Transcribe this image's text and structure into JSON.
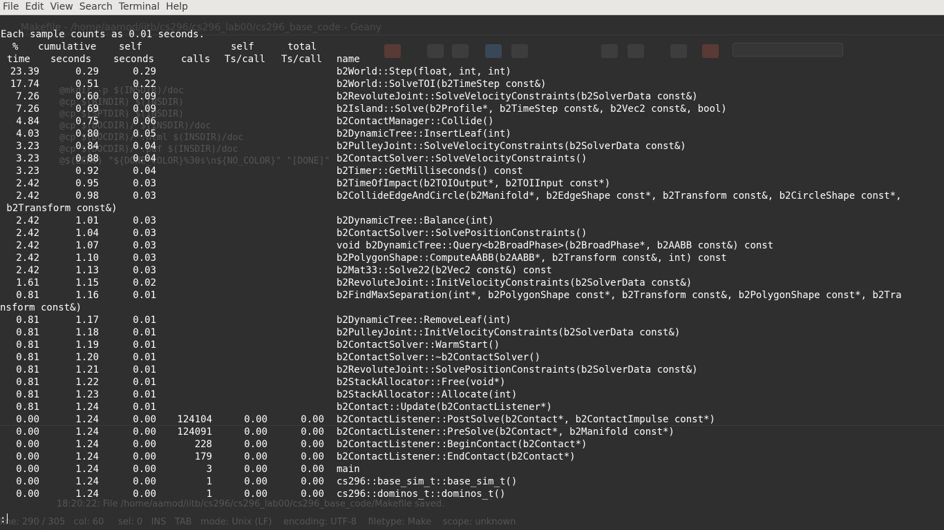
{
  "menu": [
    "File",
    "Edit",
    "View",
    "Search",
    "Terminal",
    "Help"
  ],
  "header_note": "Each sample counts as 0.01 seconds.",
  "column_headers_1": {
    "pct": "%",
    "cumulative": "cumulative",
    "self": "self",
    "self_call": "self",
    "total_call": "total"
  },
  "column_headers_2": {
    "pct": "time",
    "cumulative": "seconds",
    "self": "seconds",
    "calls": "calls",
    "self_call": "Ts/call",
    "total_call": "Ts/call",
    "name": "name"
  },
  "rows": [
    {
      "pct": "23.39",
      "cum": "0.29",
      "self": "0.29",
      "calls": "",
      "scall": "",
      "tcall": "",
      "name": "b2World::Step(float, int, int)"
    },
    {
      "pct": "17.74",
      "cum": "0.51",
      "self": "0.22",
      "calls": "",
      "scall": "",
      "tcall": "",
      "name": "b2World::SolveTOI(b2TimeStep const&)"
    },
    {
      "pct": "7.26",
      "cum": "0.60",
      "self": "0.09",
      "calls": "",
      "scall": "",
      "tcall": "",
      "name": "b2RevoluteJoint::SolveVelocityConstraints(b2SolverData const&)"
    },
    {
      "pct": "7.26",
      "cum": "0.69",
      "self": "0.09",
      "calls": "",
      "scall": "",
      "tcall": "",
      "name": "b2Island::Solve(b2Profile*, b2TimeStep const&, b2Vec2 const&, bool)"
    },
    {
      "pct": "4.84",
      "cum": "0.75",
      "self": "0.06",
      "calls": "",
      "scall": "",
      "tcall": "",
      "name": "b2ContactManager::Collide()"
    },
    {
      "pct": "4.03",
      "cum": "0.80",
      "self": "0.05",
      "calls": "",
      "scall": "",
      "tcall": "",
      "name": "b2DynamicTree::InsertLeaf(int)"
    },
    {
      "pct": "3.23",
      "cum": "0.84",
      "self": "0.04",
      "calls": "",
      "scall": "",
      "tcall": "",
      "name": "b2PulleyJoint::SolveVelocityConstraints(b2SolverData const&)"
    },
    {
      "pct": "3.23",
      "cum": "0.88",
      "self": "0.04",
      "calls": "",
      "scall": "",
      "tcall": "",
      "name": "b2ContactSolver::SolveVelocityConstraints()"
    },
    {
      "pct": "3.23",
      "cum": "0.92",
      "self": "0.04",
      "calls": "",
      "scall": "",
      "tcall": "",
      "name": "b2Timer::GetMilliseconds() const"
    },
    {
      "pct": "2.42",
      "cum": "0.95",
      "self": "0.03",
      "calls": "",
      "scall": "",
      "tcall": "",
      "name": "b2TimeOfImpact(b2TOIOutput*, b2TOIInput const*)"
    },
    {
      "pct": "2.42",
      "cum": "0.98",
      "self": "0.03",
      "calls": "",
      "scall": "",
      "tcall": "",
      "name": "b2CollideEdgeAndCircle(b2Manifold*, b2EdgeShape const*, b2Transform const&, b2CircleShape const*,",
      "wrap": " b2Transform const&)"
    },
    {
      "pct": "2.42",
      "cum": "1.01",
      "self": "0.03",
      "calls": "",
      "scall": "",
      "tcall": "",
      "name": "b2DynamicTree::Balance(int)"
    },
    {
      "pct": "2.42",
      "cum": "1.04",
      "self": "0.03",
      "calls": "",
      "scall": "",
      "tcall": "",
      "name": "b2ContactSolver::SolvePositionConstraints()"
    },
    {
      "pct": "2.42",
      "cum": "1.07",
      "self": "0.03",
      "calls": "",
      "scall": "",
      "tcall": "",
      "name": "void b2DynamicTree::Query<b2BroadPhase>(b2BroadPhase*, b2AABB const&) const"
    },
    {
      "pct": "2.42",
      "cum": "1.10",
      "self": "0.03",
      "calls": "",
      "scall": "",
      "tcall": "",
      "name": "b2PolygonShape::ComputeAABB(b2AABB*, b2Transform const&, int) const"
    },
    {
      "pct": "2.42",
      "cum": "1.13",
      "self": "0.03",
      "calls": "",
      "scall": "",
      "tcall": "",
      "name": "b2Mat33::Solve22(b2Vec2 const&) const"
    },
    {
      "pct": "1.61",
      "cum": "1.15",
      "self": "0.02",
      "calls": "",
      "scall": "",
      "tcall": "",
      "name": "b2RevoluteJoint::InitVelocityConstraints(b2SolverData const&)"
    },
    {
      "pct": "0.81",
      "cum": "1.16",
      "self": "0.01",
      "calls": "",
      "scall": "",
      "tcall": "",
      "name": "b2FindMaxSeparation(int*, b2PolygonShape const*, b2Transform const&, b2PolygonShape const*, b2Tra",
      "wrap": "nsform const&)"
    },
    {
      "pct": "0.81",
      "cum": "1.17",
      "self": "0.01",
      "calls": "",
      "scall": "",
      "tcall": "",
      "name": "b2DynamicTree::RemoveLeaf(int)"
    },
    {
      "pct": "0.81",
      "cum": "1.18",
      "self": "0.01",
      "calls": "",
      "scall": "",
      "tcall": "",
      "name": "b2PulleyJoint::InitVelocityConstraints(b2SolverData const&)"
    },
    {
      "pct": "0.81",
      "cum": "1.19",
      "self": "0.01",
      "calls": "",
      "scall": "",
      "tcall": "",
      "name": "b2ContactSolver::WarmStart()"
    },
    {
      "pct": "0.81",
      "cum": "1.20",
      "self": "0.01",
      "calls": "",
      "scall": "",
      "tcall": "",
      "name": "b2ContactSolver::~b2ContactSolver()"
    },
    {
      "pct": "0.81",
      "cum": "1.21",
      "self": "0.01",
      "calls": "",
      "scall": "",
      "tcall": "",
      "name": "b2RevoluteJoint::SolvePositionConstraints(b2SolverData const&)"
    },
    {
      "pct": "0.81",
      "cum": "1.22",
      "self": "0.01",
      "calls": "",
      "scall": "",
      "tcall": "",
      "name": "b2StackAllocator::Free(void*)"
    },
    {
      "pct": "0.81",
      "cum": "1.23",
      "self": "0.01",
      "calls": "",
      "scall": "",
      "tcall": "",
      "name": "b2StackAllocator::Allocate(int)"
    },
    {
      "pct": "0.81",
      "cum": "1.24",
      "self": "0.01",
      "calls": "",
      "scall": "",
      "tcall": "",
      "name": "b2Contact::Update(b2ContactListener*)"
    },
    {
      "pct": "0.00",
      "cum": "1.24",
      "self": "0.00",
      "calls": "124104",
      "scall": "0.00",
      "tcall": "0.00",
      "name": "b2ContactListener::PostSolve(b2Contact*, b2ContactImpulse const*)"
    },
    {
      "pct": "0.00",
      "cum": "1.24",
      "self": "0.00",
      "calls": "124091",
      "scall": "0.00",
      "tcall": "0.00",
      "name": "b2ContactListener::PreSolve(b2Contact*, b2Manifold const*)"
    },
    {
      "pct": "0.00",
      "cum": "1.24",
      "self": "0.00",
      "calls": "228",
      "scall": "0.00",
      "tcall": "0.00",
      "name": "b2ContactListener::BeginContact(b2Contact*)"
    },
    {
      "pct": "0.00",
      "cum": "1.24",
      "self": "0.00",
      "calls": "179",
      "scall": "0.00",
      "tcall": "0.00",
      "name": "b2ContactListener::EndContact(b2Contact*)"
    },
    {
      "pct": "0.00",
      "cum": "1.24",
      "self": "0.00",
      "calls": "3",
      "scall": "0.00",
      "tcall": "0.00",
      "name": "main"
    },
    {
      "pct": "0.00",
      "cum": "1.24",
      "self": "0.00",
      "calls": "1",
      "scall": "0.00",
      "tcall": "0.00",
      "name": "cs296::base_sim_t::base_sim_t()"
    },
    {
      "pct": "0.00",
      "cum": "1.24",
      "self": "0.00",
      "calls": "1",
      "scall": "0.00",
      "tcall": "0.00",
      "name": "cs296::dominos_t::dominos_t()"
    }
  ],
  "prompt": ":",
  "background_editor": {
    "title": "Makefile - /home/aamod/iitb/cs296/cs296_lab00/cs296_base_code - Geany",
    "code_lines": [
      "@mkdir -p $(INSDIR)/doc",
      "@cp $(BINDIR) $(INSDIR)",
      "@cp $(SPTDIR) $(INSDIR)",
      "@cp $(DOCDIR)/ $(INSDIR)/doc",
      "@cp $(DOCDIR)/*.html $(INSDIR)/doc",
      "@cp $(DOCDIR)/*.pdf $(INSDIR)/doc",
      "@$(ECHO) \"${DONE_COLOR}%30s\\n${NO_COLOR}\" \"[DONE]\""
    ],
    "status_bar": "line: 290 / 305   col: 60     sel: 0   INS   TAB   mode: Unix (LF)    encoding: UTF-8    filetype: Make    scope: unknown",
    "log_line": "18:20:22: File /home/aamod/iitb/cs296/cs296_lab00/cs296_base_code/Makefile saved."
  },
  "colors": {
    "terminal_bg": "#2f2f2f",
    "text": "#ffffff",
    "menubar_bg": "#e8e7e3"
  }
}
